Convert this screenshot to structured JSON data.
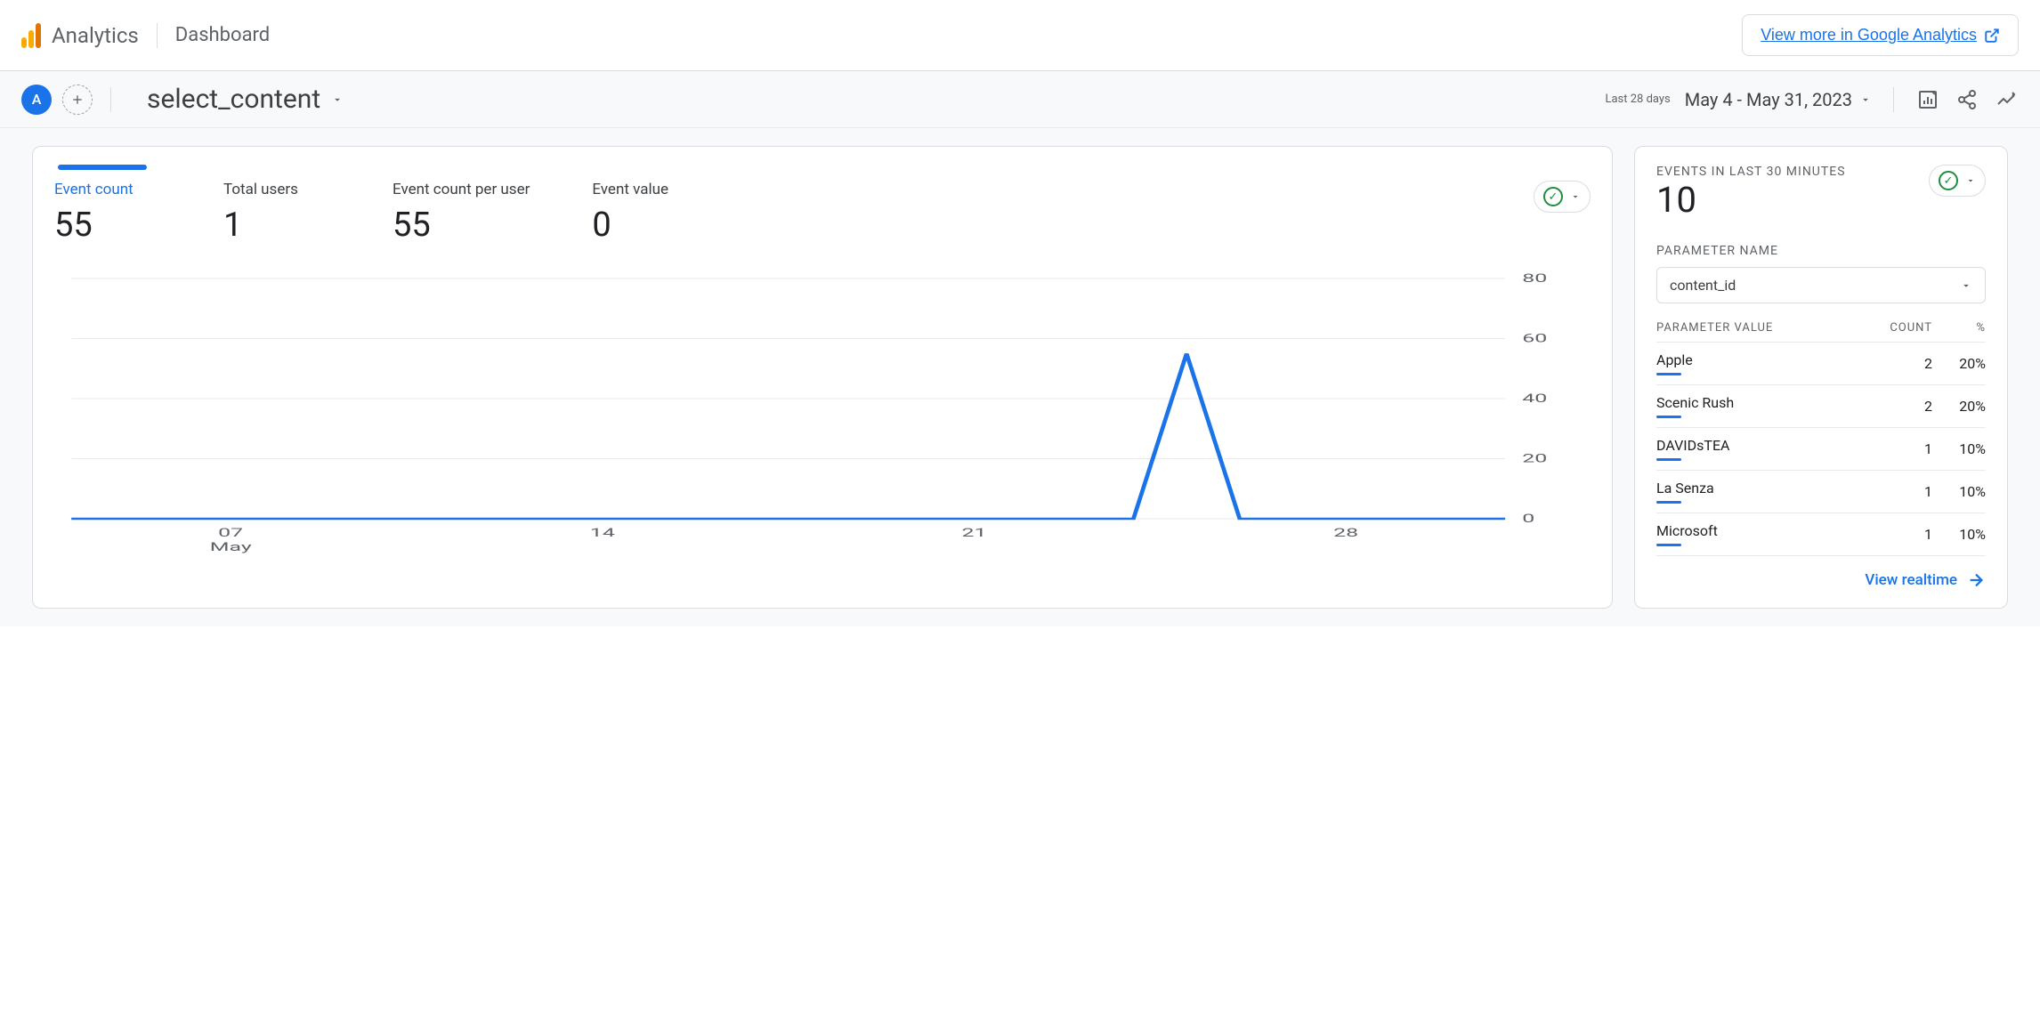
{
  "header": {
    "brand": "Analytics",
    "page": "Dashboard",
    "view_more": "View more in Google Analytics"
  },
  "subheader": {
    "avatar_letter": "A",
    "event_name": "select_content",
    "date_range_label": "Last 28 days",
    "date_range_value": "May 4 - May 31, 2023"
  },
  "metrics": [
    {
      "label": "Event count",
      "value": "55",
      "active": true
    },
    {
      "label": "Total users",
      "value": "1",
      "active": false
    },
    {
      "label": "Event count per user",
      "value": "55",
      "active": false
    },
    {
      "label": "Event value",
      "value": "0",
      "active": false
    }
  ],
  "chart_data": {
    "type": "line",
    "title": "",
    "xlabel": "May",
    "ylabel": "",
    "ylim": [
      0,
      80
    ],
    "y_ticks": [
      0,
      20,
      40,
      60,
      80
    ],
    "x_ticks": [
      "07",
      "14",
      "21",
      "28"
    ],
    "x_month": "May",
    "series": [
      {
        "name": "Event count",
        "x": [
          "04",
          "05",
          "06",
          "07",
          "08",
          "09",
          "10",
          "11",
          "12",
          "13",
          "14",
          "15",
          "16",
          "17",
          "18",
          "19",
          "20",
          "21",
          "22",
          "23",
          "24",
          "25",
          "26",
          "27",
          "28",
          "29",
          "30",
          "31"
        ],
        "values": [
          0,
          0,
          0,
          0,
          0,
          0,
          0,
          0,
          0,
          0,
          0,
          0,
          0,
          0,
          0,
          0,
          0,
          0,
          0,
          0,
          0,
          55,
          0,
          0,
          0,
          0,
          0,
          0
        ]
      }
    ]
  },
  "realtime": {
    "title": "EVENTS IN LAST 30 MINUTES",
    "value": "10",
    "param_label": "PARAMETER NAME",
    "param_selected": "content_id",
    "table": {
      "headers": {
        "value": "PARAMETER VALUE",
        "count": "COUNT",
        "pct": "%"
      },
      "rows": [
        {
          "name": "Apple",
          "count": "2",
          "pct": "20%"
        },
        {
          "name": "Scenic Rush",
          "count": "2",
          "pct": "20%"
        },
        {
          "name": "DAVIDsTEA",
          "count": "1",
          "pct": "10%"
        },
        {
          "name": "La Senza",
          "count": "1",
          "pct": "10%"
        },
        {
          "name": "Microsoft",
          "count": "1",
          "pct": "10%"
        }
      ]
    },
    "view_link": "View realtime"
  }
}
